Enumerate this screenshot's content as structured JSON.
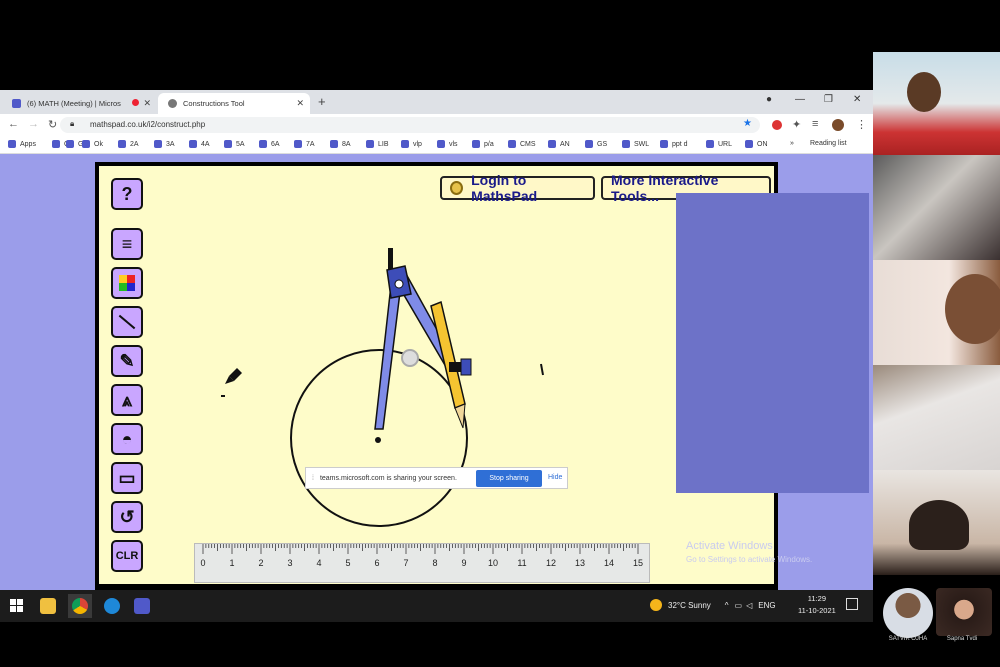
{
  "browser": {
    "tabs": [
      {
        "label": "(6) MATH (Meeting) | Micros",
        "active": false
      },
      {
        "label": "Constructions Tool",
        "active": true
      }
    ],
    "url": "mathspad.co.uk/i2/construct.php",
    "bookmarks": [
      "Apps",
      "G",
      "G",
      "Ok",
      "2A",
      "3A",
      "4A",
      "5A",
      "6A",
      "7A",
      "8A",
      "LIB",
      "vlp",
      "vls",
      "p/a",
      "CMS",
      "AN",
      "GS",
      "SWL",
      "ppt d",
      "URL",
      "ON"
    ],
    "reading_list": "Reading list"
  },
  "app": {
    "login_label": "Login to MathsPad",
    "tools_label": "More Interactive Tools...",
    "toolbar": [
      {
        "name": "help",
        "glyph": "?"
      },
      {
        "name": "menu",
        "glyph": "≡"
      },
      {
        "name": "colors",
        "glyph": ""
      },
      {
        "name": "line",
        "glyph": ""
      },
      {
        "name": "pencil",
        "glyph": "✎"
      },
      {
        "name": "compass",
        "glyph": "⩓"
      },
      {
        "name": "protractor",
        "glyph": "◓"
      },
      {
        "name": "ruler",
        "glyph": "▭"
      },
      {
        "name": "undo",
        "glyph": "↺"
      },
      {
        "name": "clear",
        "glyph": "CLR"
      }
    ],
    "ruler_ticks": [
      "0",
      "1",
      "2",
      "3",
      "4",
      "5",
      "6",
      "7",
      "8",
      "9",
      "10",
      "11",
      "12",
      "13",
      "14",
      "15"
    ]
  },
  "share_bar": {
    "message": "teams.microsoft.com is sharing your screen.",
    "stop_label": "Stop sharing",
    "hide_label": "Hide"
  },
  "watermark": {
    "title": "Activate Windows",
    "subtitle": "Go to Settings to activate Windows."
  },
  "taskbar": {
    "weather": "32°C  Sunny",
    "lang": "ENG",
    "time": "11:29",
    "date": "11-10-2021"
  },
  "participants": [
    {
      "name": "SATVIK OJHA"
    },
    {
      "name": "Sapna Tvdi"
    }
  ],
  "colors": {
    "page_bg": "#9b9dea",
    "canvas_bg": "#fefcc9",
    "tool_bg": "#c9a6ff",
    "accent": "#1a1a8a"
  }
}
